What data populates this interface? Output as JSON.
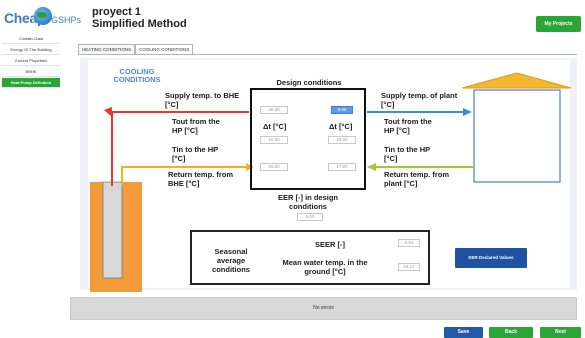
{
  "logo": {
    "part1": "Cheap",
    "part2": "GSHPs"
  },
  "project": {
    "name": "proyect 1",
    "method": "Simplified Method"
  },
  "header": {
    "my_projects": "My Projects"
  },
  "sidebar": {
    "items": [
      {
        "label": "Climatic Data"
      },
      {
        "label": "Energy Of The Building"
      },
      {
        "label": "Ground Properties"
      },
      {
        "label": "BBHE"
      },
      {
        "label": "Heat Pump Definition"
      }
    ]
  },
  "tabs": [
    {
      "label": "HEATING CONDITIONS"
    },
    {
      "label": "COOLING CONDITIONS"
    }
  ],
  "diagram": {
    "title": "COOLING CONDITIONS",
    "design_conditions": "Design conditions",
    "left": {
      "supply_bhe": "Supply temp. to BHE [°C]",
      "tout": "Tout from the HP [°C]",
      "tin": "Tin to the HP [°C]",
      "return_bhe": "Return temp. from BHE [°C]"
    },
    "right": {
      "supply_plant": "Supply temp. of plant [°C]",
      "tout": "Tout from the HP [°C]",
      "tin": "Tin to the HP [°C]",
      "return_plant": "Return temp. from plant [°C]"
    },
    "delta_t_left": "Δt [°C]",
    "delta_t_right": "Δt [°C]",
    "inputs": {
      "supply_bhe": "26.00",
      "supply_plant": "8.00",
      "dt_left": "10.00",
      "dt_right": "10.00",
      "return_bhe": "26.00",
      "return_plant": "17.00"
    },
    "eer_label": "EER [-] in design conditions",
    "eer_value": "5.00"
  },
  "seasonal": {
    "label": "Seasonal average conditions",
    "seer_label": "SEER [-]",
    "seer_value": "6.61",
    "mean_temp_label": "Mean water temp. in the ground [°C]",
    "mean_temp_value": "15.17"
  },
  "buttons": {
    "eer_declared": "EER Declared Values",
    "save": "Save",
    "back": "Back",
    "next": "Next"
  },
  "status": {
    "message": "No errors"
  },
  "colors": {
    "green": "#2ca537",
    "blue_button": "#1f53a2",
    "hot_pipe": "#e53935",
    "warm_pipe": "#f2b21d",
    "plant_pipe": "#3b8de0",
    "return_pipe": "#9ccc3a",
    "bhe": "#f39a3b"
  }
}
